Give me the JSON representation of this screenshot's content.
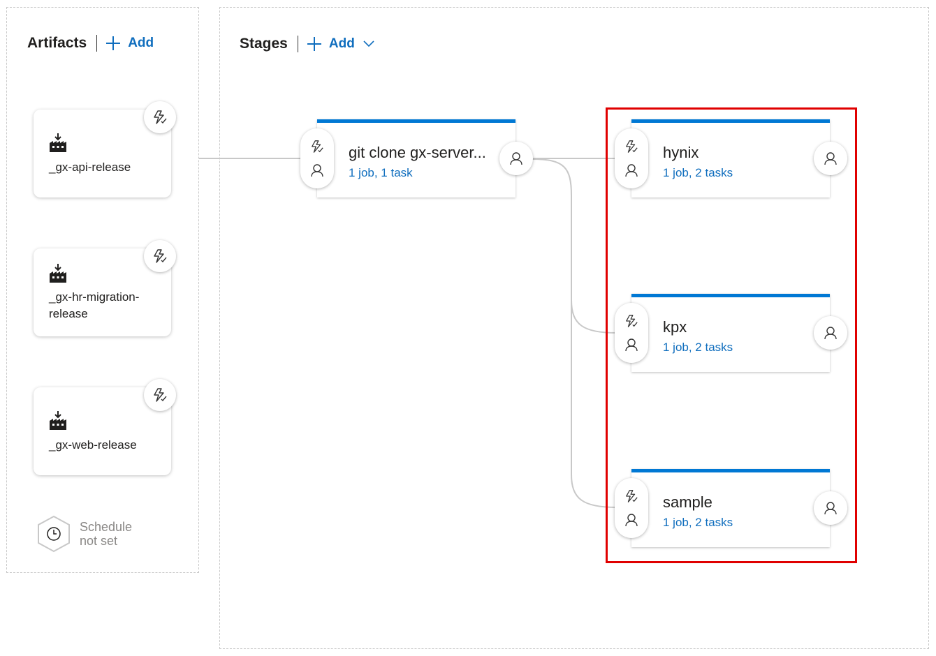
{
  "artifacts": {
    "title": "Artifacts",
    "add_label": "Add",
    "items": [
      {
        "name": "_gx-api-release"
      },
      {
        "name": "_gx-hr-migration-release"
      },
      {
        "name": "_gx-web-release"
      }
    ],
    "schedule": {
      "line1": "Schedule",
      "line2": "not set"
    }
  },
  "stages": {
    "title": "Stages",
    "add_label": "Add",
    "items": [
      {
        "name": "git clone gx-server...",
        "summary": "1 job, 1 task"
      },
      {
        "name": "hynix",
        "summary": "1 job, 2 tasks"
      },
      {
        "name": "kpx",
        "summary": "1 job, 2 tasks"
      },
      {
        "name": "sample",
        "summary": "1 job, 2 tasks"
      }
    ]
  },
  "colors": {
    "accent": "#0078d4",
    "link": "#106ebe",
    "highlight": "#e00000"
  },
  "icons": [
    "plus-icon",
    "chevron-down-icon",
    "build-artifact-icon",
    "lightning-trigger-icon",
    "person-approval-icon",
    "clock-icon"
  ]
}
